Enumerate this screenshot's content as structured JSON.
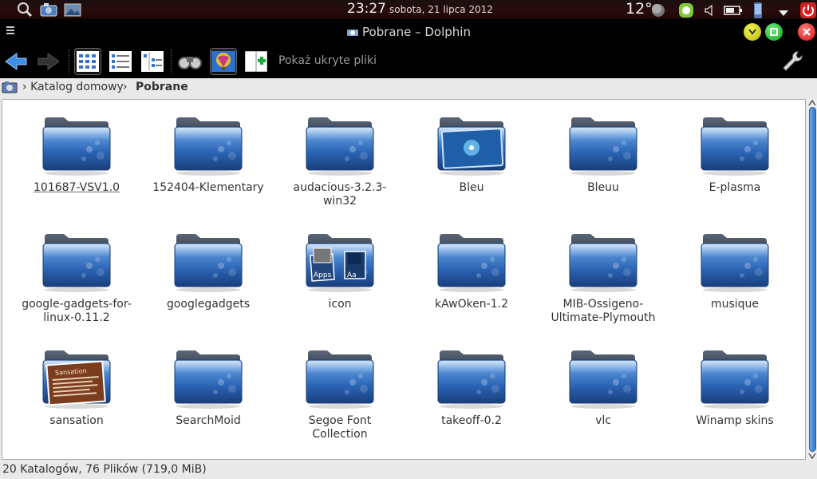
{
  "panel": {
    "time": "23:27",
    "date": "sobota, 21 lipca 2012",
    "temperature": "12°",
    "icons": [
      "search-icon",
      "camera-icon",
      "image-icon",
      "weather-icon",
      "evernote-icon",
      "volume-icon",
      "battery-icon",
      "phone-icon",
      "chevron-down-icon",
      "power-icon"
    ]
  },
  "window": {
    "title": "Pobrane – Dolphin"
  },
  "toolbar": {
    "show_hidden": "Pokaż ukryte pliki",
    "buttons": [
      "back",
      "forward",
      "icons-view",
      "details-view",
      "columns-view",
      "find",
      "preview",
      "split"
    ]
  },
  "breadcrumb": {
    "home": "Katalog domowy",
    "current": "Pobrane"
  },
  "items": [
    {
      "label": "101687-VSV1.0",
      "icon": "folder"
    },
    {
      "label": "152404-Klementary",
      "icon": "folder"
    },
    {
      "label": "audacious-3.2.3-win32",
      "icon": "folder"
    },
    {
      "label": "Bleu",
      "icon": "folder-preview-blue"
    },
    {
      "label": "Bleuu",
      "icon": "folder"
    },
    {
      "label": "E-plasma",
      "icon": "folder"
    },
    {
      "label": "google-gadgets-for-linux-0.11.2",
      "icon": "folder"
    },
    {
      "label": "googlegadgets",
      "icon": "folder"
    },
    {
      "label": "icon",
      "icon": "folder-preview-apps"
    },
    {
      "label": "kAwOken-1.2",
      "icon": "folder"
    },
    {
      "label": "MIB-Ossigeno-Ultimate-Plymouth",
      "icon": "folder"
    },
    {
      "label": "musique",
      "icon": "folder"
    },
    {
      "label": "sansation",
      "icon": "folder-preview-font"
    },
    {
      "label": "SearchMoid",
      "icon": "folder"
    },
    {
      "label": "Segoe Font Collection",
      "icon": "folder"
    },
    {
      "label": "takeoff-0.2",
      "icon": "folder"
    },
    {
      "label": "vlc",
      "icon": "folder"
    },
    {
      "label": "Winamp skins",
      "icon": "folder"
    }
  ],
  "preview_text": {
    "apps": "Apps",
    "aa": "Aa",
    "sansation": "Sansation"
  },
  "status": {
    "text": "20 Katalogów, 76 Plików (719,0 MiB)"
  },
  "colors": {
    "folder_top": "#8ea0b4",
    "folder_body": "#2f6fc3",
    "accent": "#2f74c9"
  }
}
